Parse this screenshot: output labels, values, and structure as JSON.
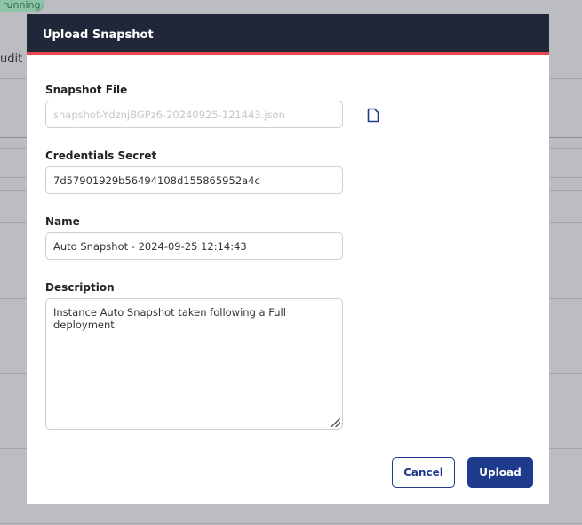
{
  "background": {
    "status_badge": "running",
    "tab_text": "udit L"
  },
  "modal": {
    "title": "Upload Snapshot",
    "snapshot_file": {
      "label": "Snapshot File",
      "placeholder": "snapshot-YdznjBGPz6-20240925-121443.json",
      "icon": "file-icon"
    },
    "credentials_secret": {
      "label": "Credentials Secret",
      "value": "7d57901929b56494108d155865952a4c"
    },
    "name": {
      "label": "Name",
      "value": "Auto Snapshot - 2024-09-25 12:14:43"
    },
    "description": {
      "label": "Description",
      "value": "Instance Auto Snapshot taken following a Full deployment"
    },
    "cancel_label": "Cancel",
    "upload_label": "Upload"
  },
  "colors": {
    "header": "#1f2738",
    "accent_line": "#e5484d",
    "primary": "#1e3a8a"
  }
}
